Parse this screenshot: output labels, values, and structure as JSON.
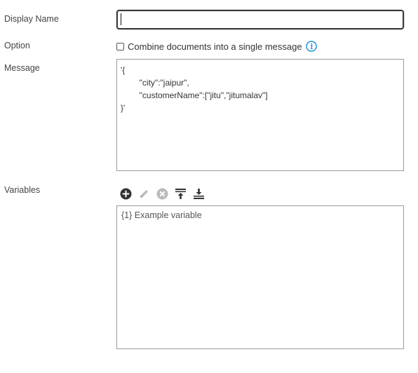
{
  "form": {
    "display_name_label": "Display Name",
    "display_name_value": "",
    "option_label": "Option",
    "combine_documents_label": "Combine documents into a single message",
    "combine_documents_checked": false,
    "message_label": "Message",
    "message_lines": [
      "'{",
      "        \"city\":\"jaipur\",",
      "        \"customerName\":[\"jitu\",\"jitumalav\"]",
      "}'"
    ],
    "variables_label": "Variables",
    "variables": [
      "{1} Example variable"
    ]
  },
  "toolbar": {
    "icons": [
      "add-icon",
      "edit-icon",
      "remove-icon",
      "move-top-icon",
      "move-bottom-icon"
    ]
  },
  "colors": {
    "info_icon": "#1a8fd6",
    "toolbar_active": "#333333",
    "toolbar_disabled": "#bbbbbb"
  }
}
